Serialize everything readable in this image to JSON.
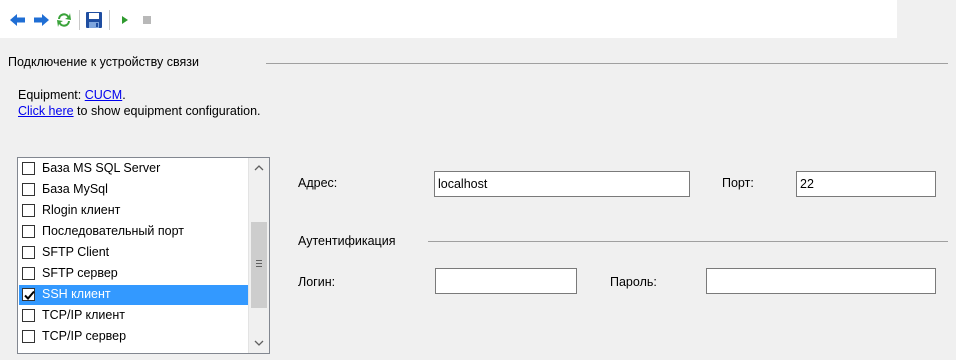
{
  "toolbar": {
    "buttons": [
      {
        "name": "back",
        "icon": "arrow-left-icon"
      },
      {
        "name": "forward",
        "icon": "arrow-right-icon"
      },
      {
        "name": "refresh",
        "icon": "refresh-icon"
      },
      {
        "name": "save",
        "icon": "save-icon"
      },
      {
        "name": "run",
        "icon": "play-icon"
      },
      {
        "name": "stop",
        "icon": "stop-icon"
      }
    ],
    "colors": {
      "arrows": "#1f6ed4",
      "refresh": "#3aa33a",
      "save": "#1f4ea1"
    }
  },
  "connection_group": {
    "title": "Подключение к устройству связи",
    "equipment_prefix": "Equipment: ",
    "equipment_link": "CUCM",
    "equipment_suffix": ".",
    "click_link": "Click here",
    "click_suffix": " to show equipment configuration."
  },
  "connection_types": {
    "items": [
      {
        "label": "База MS SQL Server",
        "checked": false,
        "selected": false
      },
      {
        "label": "База MySql",
        "checked": false,
        "selected": false
      },
      {
        "label": "Rlogin клиент",
        "checked": false,
        "selected": false
      },
      {
        "label": "Последовательный порт",
        "checked": false,
        "selected": false
      },
      {
        "label": "SFTP Client",
        "checked": false,
        "selected": false
      },
      {
        "label": "SFTP сервер",
        "checked": false,
        "selected": false
      },
      {
        "label": "SSH клиент",
        "checked": true,
        "selected": true
      },
      {
        "label": "TCP/IP клиент",
        "checked": false,
        "selected": false
      },
      {
        "label": "TCP/IP сервер",
        "checked": false,
        "selected": false
      }
    ],
    "selection_color": "#3399ff"
  },
  "settings": {
    "address_label": "Адрес:",
    "address_value": "localhost",
    "port_label": "Порт:",
    "port_value": "22",
    "auth_title": "Аутентификация",
    "login_label": "Логин:",
    "login_value": "",
    "password_label": "Пароль:",
    "password_value": ""
  }
}
